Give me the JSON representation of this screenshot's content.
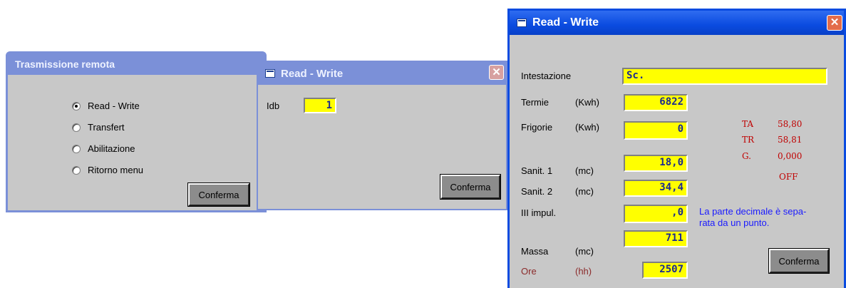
{
  "trasmissione": {
    "title": "Trasmissione remota",
    "options": [
      {
        "label": "Read - Write",
        "selected": true
      },
      {
        "label": "Transfert",
        "selected": false
      },
      {
        "label": "Abilitazione",
        "selected": false
      },
      {
        "label": "Ritorno menu",
        "selected": false
      }
    ],
    "confirm_label": "Conferma"
  },
  "rw_small": {
    "title": "Read - Write",
    "close_label": "✕",
    "idb_label": "Idb",
    "idb_value": "1",
    "confirm_label": "Conferma"
  },
  "rw_large": {
    "title": "Read - Write",
    "close_label": "✕",
    "intestazione_label": "Intestazione",
    "intestazione_value": "Sc.",
    "termie_label": "Termie",
    "termie_unit": "(Kwh)",
    "termie_value": "6822",
    "frigorie_label": "Frigorie",
    "frigorie_unit": "(Kwh)",
    "frigorie_value": "0",
    "sanit1_label": "Sanit. 1",
    "sanit1_unit": "(mc)",
    "sanit1_value": "18,0",
    "sanit2_label": "Sanit. 2",
    "sanit2_unit": "(mc)",
    "sanit2_value": "34,4",
    "impul_label": "III impul.",
    "impul_value": ",0",
    "massa_label": "Massa",
    "massa_unit": "(mc)",
    "massa_value": "711",
    "ore_label": "Ore",
    "ore_unit": "(hh)",
    "ore_value": "2507",
    "ta_label": "TA",
    "ta_value": "58,80",
    "tr_label": "TR",
    "tr_value": "58,81",
    "g_label": "G.",
    "g_value": "0,000",
    "status": "OFF",
    "note_line1": "La parte decimale è sepa-",
    "note_line2": "rata da un  punto.",
    "confirm_label": "Conferma"
  },
  "colors": {
    "field_bg": "#ffff00",
    "field_text": "#1b2a8f",
    "title_active": "#0a4be0",
    "title_inactive": "#7b90d8",
    "note": "#1a1aff",
    "readout": "#c00000"
  }
}
